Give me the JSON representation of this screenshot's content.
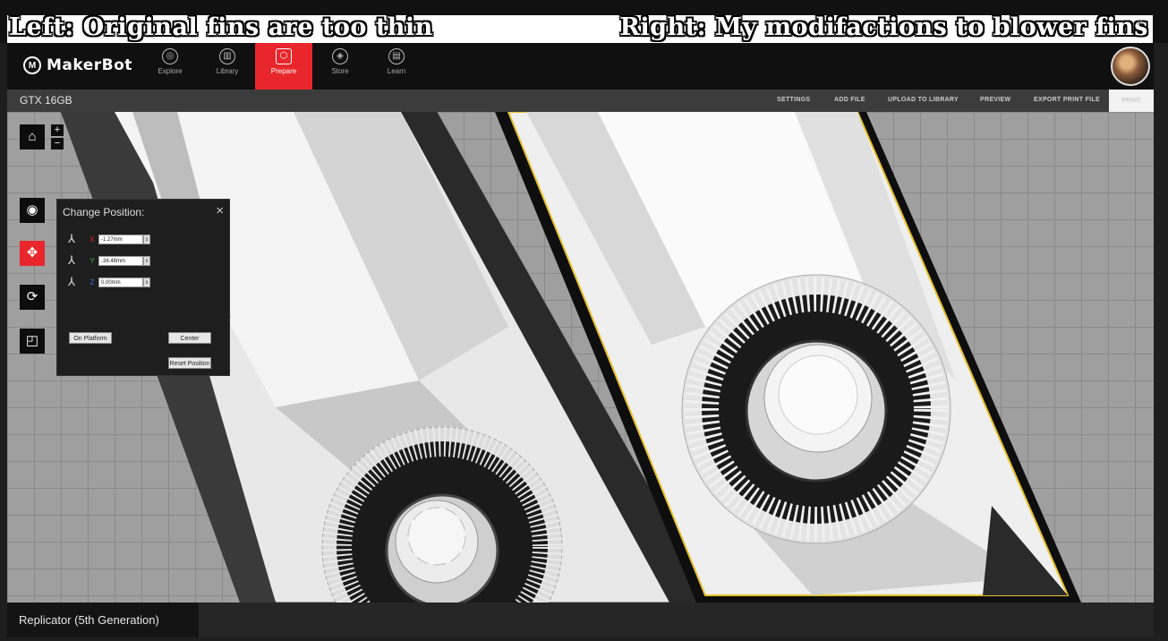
{
  "caption": {
    "left": "Left: Original fins are too thin",
    "right": "Right: My modifactions to blower fins",
    "close_glyph": "×"
  },
  "app": {
    "brand": "MakerBot",
    "nav": [
      {
        "label": "Explore",
        "icon": "compass-icon",
        "glyph": "◎"
      },
      {
        "label": "Library",
        "icon": "books-icon",
        "glyph": "▥"
      },
      {
        "label": "Prepare",
        "icon": "hexagon-icon",
        "glyph": "⬡"
      },
      {
        "label": "Store",
        "icon": "cube-icon",
        "glyph": "◈"
      },
      {
        "label": "Learn",
        "icon": "book-icon",
        "glyph": "▤"
      }
    ],
    "active_nav": "Prepare"
  },
  "toolbar": {
    "project_name": "GTX 16GB",
    "buttons": [
      "SETTINGS",
      "ADD FILE",
      "UPLOAD TO LIBRARY",
      "PREVIEW",
      "EXPORT PRINT FILE"
    ],
    "print": "PRINT"
  },
  "tools": {
    "zoom_in": "+",
    "zoom_out": "−",
    "home_glyph": "⌂",
    "view_glyph": "◉",
    "move_glyph": "✥",
    "rotate_glyph": "⟳",
    "scale_glyph": "◰"
  },
  "change_position": {
    "title": "Change Position:",
    "close": "×",
    "axes": [
      {
        "label": "X",
        "value": "-1.27mm",
        "color": "#e8262b"
      },
      {
        "label": "Y",
        "value": "-38.48mm",
        "color": "#3fae3f"
      },
      {
        "label": "Z",
        "value": "0.00mm",
        "color": "#3a6fd8"
      }
    ],
    "on_platform": "On Platform",
    "center": "Center",
    "reset": "Reset Position"
  },
  "status": {
    "printer": "Replicator (5th Generation)"
  },
  "colors": {
    "accent": "#e8262b",
    "nav_bg": "#101010",
    "toolbar_bg": "#3c3c3c",
    "plate": "#9f9f9f",
    "outline": "#e6c22a"
  }
}
